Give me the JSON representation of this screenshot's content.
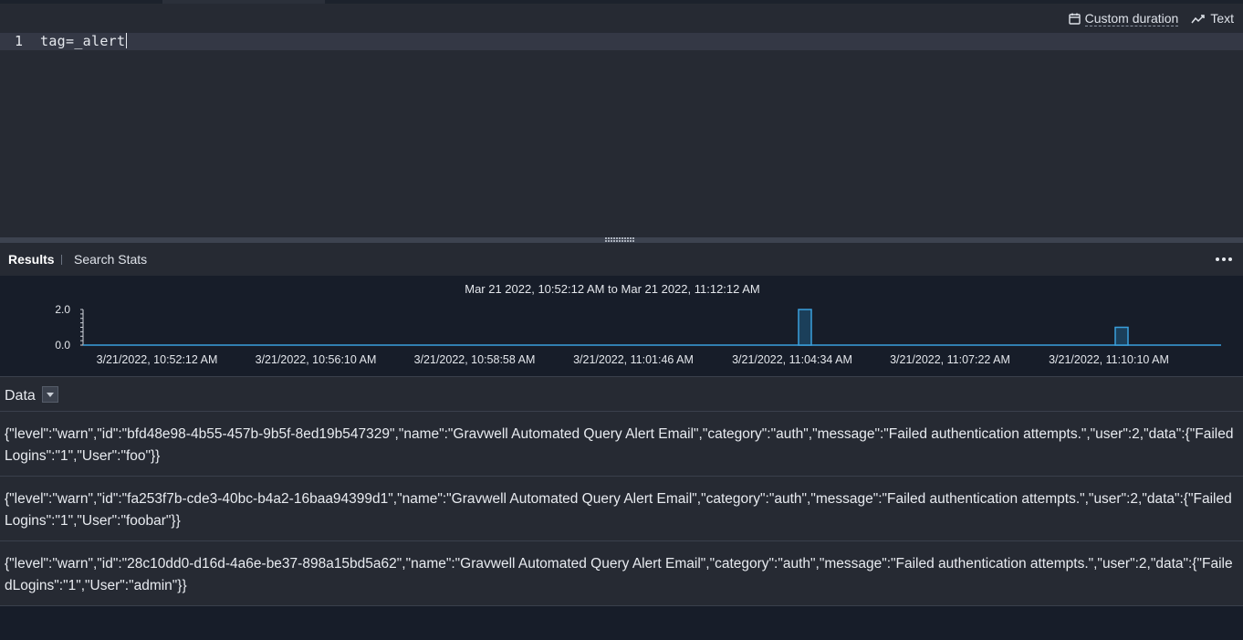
{
  "toolbar": {
    "duration_label": "Custom duration",
    "duration_icon": "calendar-icon",
    "text_label": "Text",
    "text_icon": "trend-line-icon"
  },
  "editor": {
    "line_number": "1",
    "query": "tag=_alert"
  },
  "results": {
    "tabs": [
      {
        "label": "Results",
        "active": true
      },
      {
        "label": "Search Stats",
        "active": false
      }
    ],
    "more_icon": "more-horizontal-icon"
  },
  "chart_data": {
    "type": "bar",
    "title": "Mar 21 2022, 10:52:12 AM to Mar 21 2022, 11:12:12 AM",
    "x_ticks": [
      "3/21/2022, 10:52:12 AM",
      "3/21/2022, 10:56:10 AM",
      "3/21/2022, 10:58:58 AM",
      "3/21/2022, 11:01:46 AM",
      "3/21/2022, 11:04:34 AM",
      "3/21/2022, 11:07:22 AM",
      "3/21/2022, 11:10:10 AM"
    ],
    "y_ticks": [
      "2.0",
      "0.0"
    ],
    "ylim": [
      0,
      2
    ],
    "bars": [
      {
        "x": "3/21/2022, 11:04:34 AM",
        "value": 2
      },
      {
        "x": "3/21/2022, 11:10:10 AM",
        "value": 1
      }
    ],
    "colors": {
      "line": "#3aa0dd",
      "bar_fill": "#1b3f5a",
      "bar_stroke": "#3aa0dd"
    }
  },
  "data_column": {
    "label": "Data",
    "dropdown_icon": "caret-down-icon"
  },
  "rows": [
    "{\"level\":\"warn\",\"id\":\"bfd48e98-4b55-457b-9b5f-8ed19b547329\",\"name\":\"Gravwell Automated Query Alert Email\",\"category\":\"auth\",\"message\":\"Failed authentication attempts.\",\"user\":2,\"data\":{\"FailedLogins\":\"1\",\"User\":\"foo\"}}",
    "{\"level\":\"warn\",\"id\":\"fa253f7b-cde3-40bc-b4a2-16baa94399d1\",\"name\":\"Gravwell Automated Query Alert Email\",\"category\":\"auth\",\"message\":\"Failed authentication attempts.\",\"user\":2,\"data\":{\"FailedLogins\":\"1\",\"User\":\"foobar\"}}",
    "{\"level\":\"warn\",\"id\":\"28c10dd0-d16d-4a6e-be37-898a15bd5a62\",\"name\":\"Gravwell Automated Query Alert Email\",\"category\":\"auth\",\"message\":\"Failed authentication attempts.\",\"user\":2,\"data\":{\"FailedLogins\":\"1\",\"User\":\"admin\"}}"
  ]
}
